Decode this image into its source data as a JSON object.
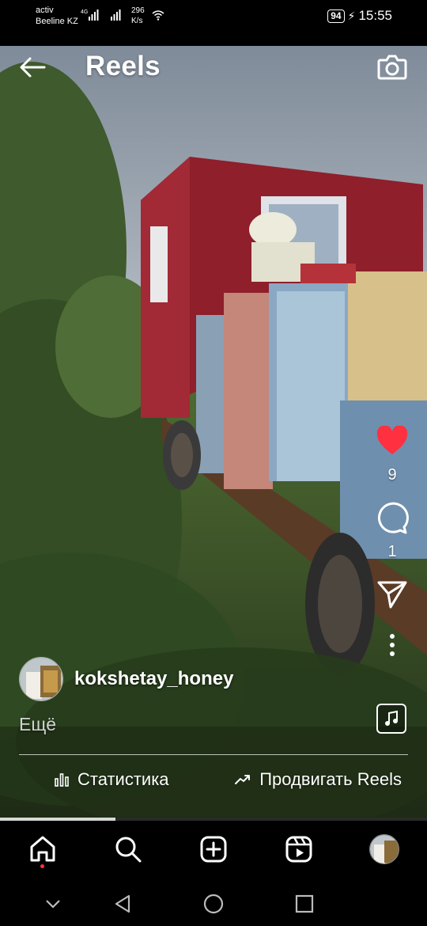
{
  "status_bar": {
    "carrier_top": "activ",
    "carrier_bottom": "Beeline KZ",
    "speed_value": "296",
    "speed_unit": "K/s",
    "battery": "94",
    "time": "15:55"
  },
  "header": {
    "title": "Reels",
    "back_icon": "arrow-left-icon",
    "camera_icon": "camera-icon"
  },
  "actions": {
    "likes": "9",
    "comments": "1",
    "like_icon": "heart-filled-icon",
    "like_color": "#ff3040",
    "comment_icon": "comment-icon",
    "share_icon": "send-icon",
    "more_icon": "more-vertical-icon"
  },
  "post": {
    "username": "kokshetay_honey",
    "more_label": "Ещё",
    "audio_icon": "music-note-icon"
  },
  "footer": {
    "stats_label": "Статистика",
    "promote_label": "Продвигать Reels"
  },
  "progress": {
    "fraction": 0.27
  },
  "bottom_nav": {
    "items": [
      "home-icon",
      "search-icon",
      "create-post-icon",
      "reels-icon",
      "profile-avatar"
    ],
    "active": "home-icon"
  },
  "system_nav": [
    "chevron-down-icon",
    "back-triangle-icon",
    "home-circle-icon",
    "recents-square-icon"
  ]
}
